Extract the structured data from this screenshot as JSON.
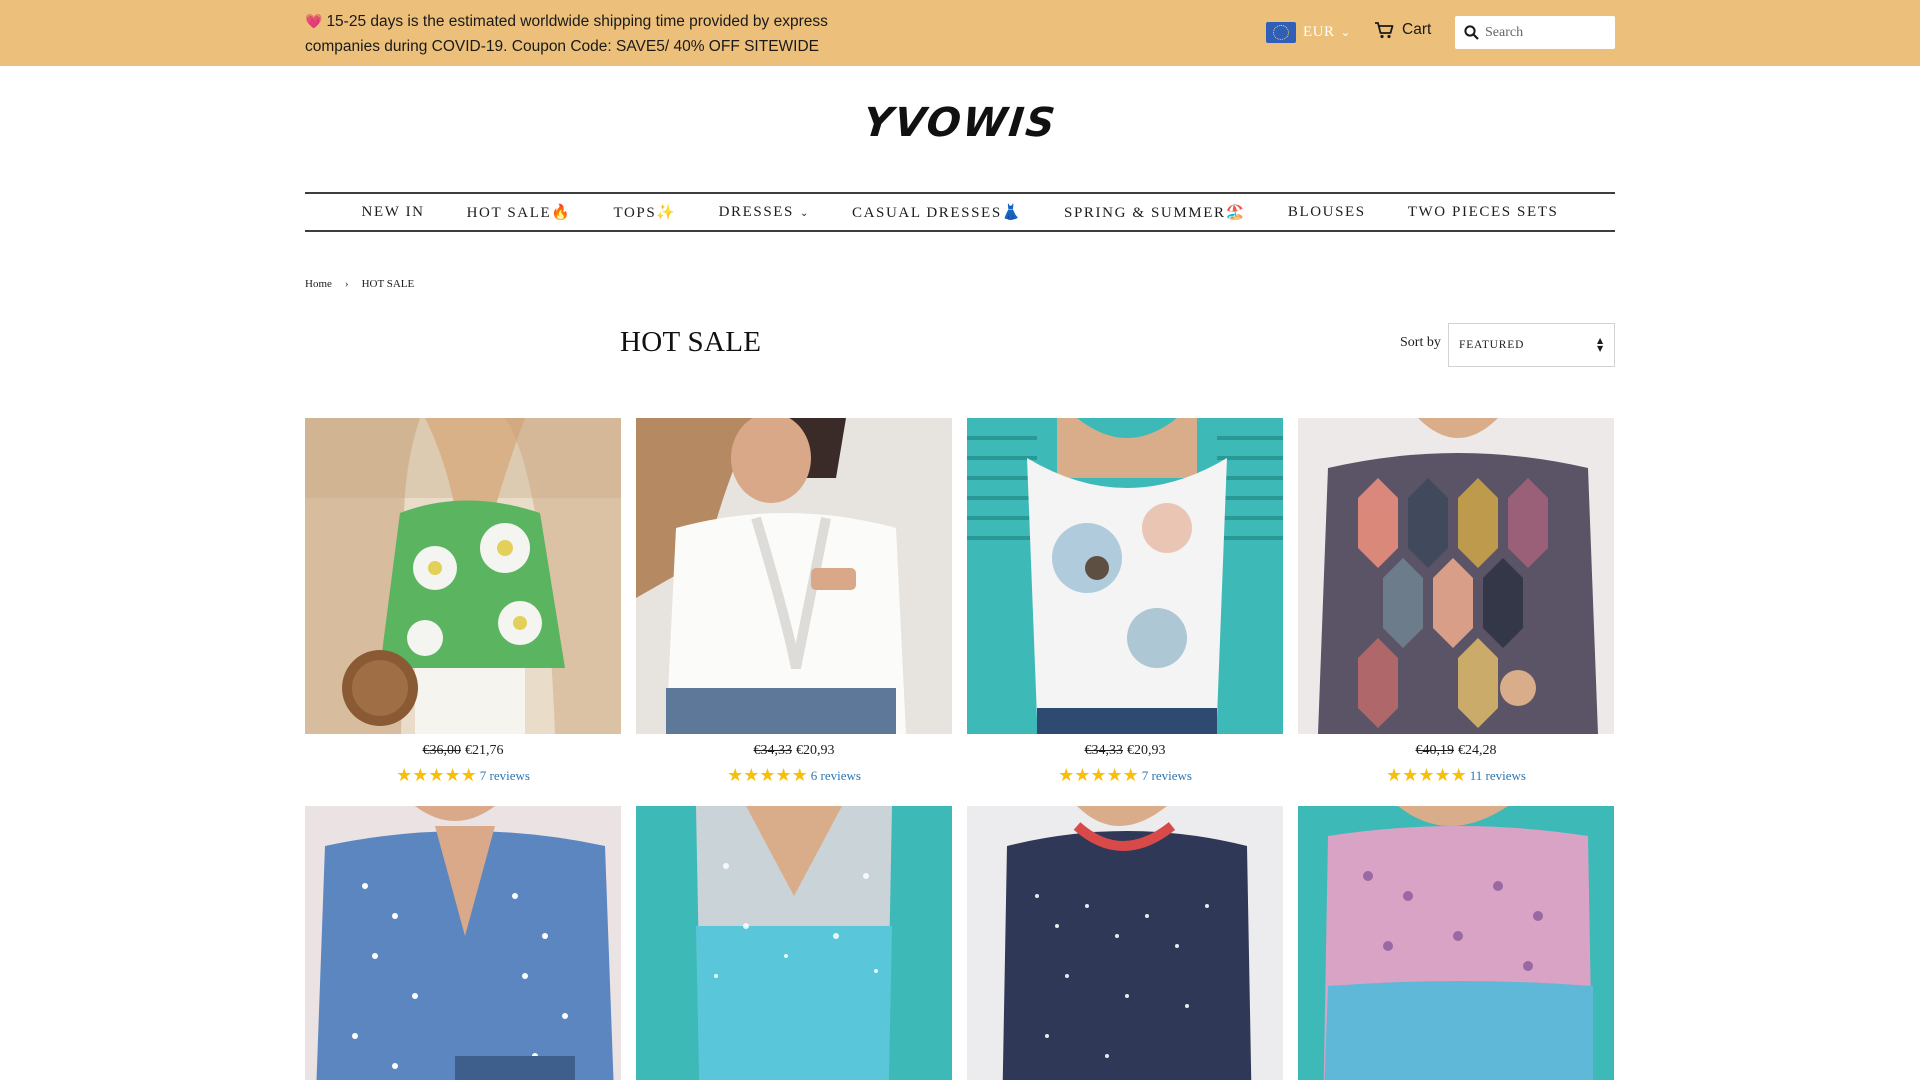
{
  "announcement": {
    "icon": "heart-icon",
    "text": "15-25 days is the estimated worldwide shipping time provided by express companies during COVID-19. Coupon Code: SAVE5/ 40% OFF SITEWIDE"
  },
  "header": {
    "currency": "EUR",
    "cart_label": "Cart",
    "search_placeholder": "Search",
    "brand_color": "#ecc07a",
    "logo": "YVOWIS"
  },
  "nav": {
    "items": [
      {
        "label": "NEW IN"
      },
      {
        "label": "HOT SALE🔥"
      },
      {
        "label": "TOPS✨"
      },
      {
        "label": "DRESSES"
      },
      {
        "label": "CASUAL DRESSES👗"
      },
      {
        "label": "SPRING & SUMMER🏖️"
      },
      {
        "label": "BLOUSES"
      },
      {
        "label": "TWO PIECES SETS"
      }
    ],
    "dresses_chevron": "⌄"
  },
  "breadcrumb": {
    "home": "Home",
    "sep": "›",
    "current": "HOT SALE"
  },
  "collection": {
    "title": "HOT SALE",
    "sort_label": "Sort by",
    "sort_value": "FEATURED"
  },
  "products": [
    {
      "old_price": "€36,00",
      "price": "€21,76",
      "stars": "★★★★★",
      "reviews": "7 reviews"
    },
    {
      "old_price": "€34,33",
      "price": "€20,93",
      "stars": "★★★★★",
      "reviews": "6 reviews"
    },
    {
      "old_price": "€34,33",
      "price": "€20,93",
      "stars": "★★★★★",
      "reviews": "7 reviews"
    },
    {
      "old_price": "€40,19",
      "price": "€24,28",
      "stars": "★★★★★",
      "reviews": "11 reviews"
    },
    {
      "old_price": "",
      "price": "",
      "stars": "",
      "reviews": ""
    },
    {
      "old_price": "",
      "price": "",
      "stars": "",
      "reviews": ""
    },
    {
      "old_price": "",
      "price": "",
      "stars": "",
      "reviews": ""
    },
    {
      "old_price": "",
      "price": "",
      "stars": "",
      "reviews": ""
    }
  ],
  "colors": {
    "star": "#f5bf0a",
    "link": "#2d75b3"
  }
}
